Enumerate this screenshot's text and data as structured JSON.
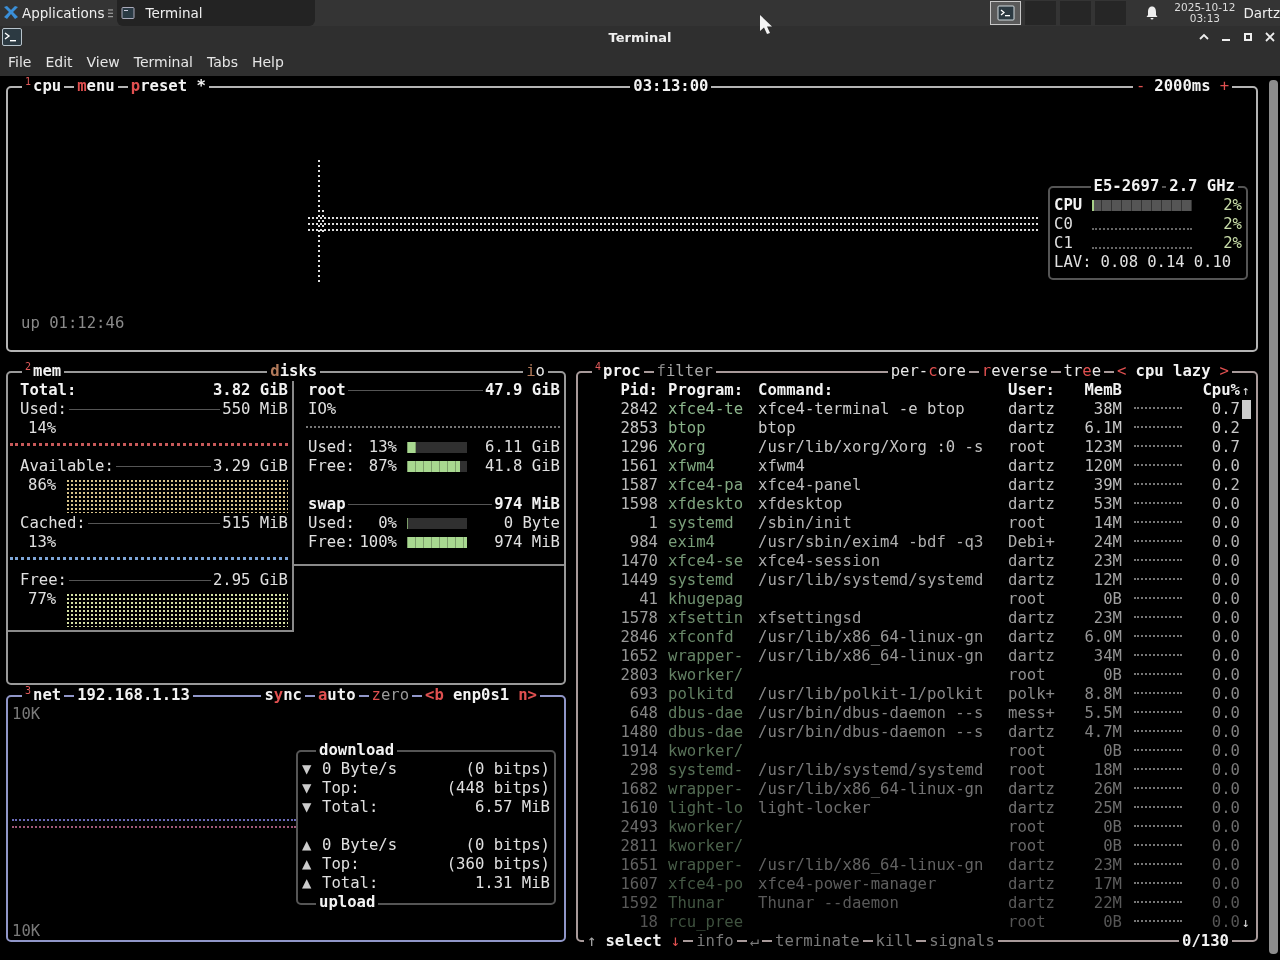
{
  "top_panel": {
    "applications": "Applications",
    "tasks": [
      {
        "label": "Terminal",
        "selected": true
      }
    ],
    "workspaces": [
      {
        "selected": true
      },
      {
        "selected": false
      },
      {
        "selected": false
      },
      {
        "selected": false
      }
    ],
    "date": "2025-10-12",
    "time": "03:13",
    "user": "Dartz"
  },
  "window": {
    "title": "Terminal"
  },
  "menu": [
    "File",
    "Edit",
    "View",
    "Terminal",
    "Tabs",
    "Help"
  ],
  "cpu": {
    "num": "1",
    "label": "cpu",
    "buttons": [
      {
        "key": "m",
        "rest": "enu"
      },
      {
        "key": "p",
        "rest": "reset *"
      }
    ],
    "clock": "03:13:00",
    "interval": {
      "minus": "-",
      "value": "2000ms",
      "plus": "+"
    },
    "uptime": "up 01:12:46",
    "info": {
      "model": "E5-2697",
      "freq": "2.7 GHz",
      "total": {
        "label": "CPU",
        "level": 0.02,
        "percent": "2%"
      },
      "cores": [
        {
          "label": "C0",
          "percent": "2%"
        },
        {
          "label": "C1",
          "percent": "2%"
        }
      ],
      "load_label": "LAV:",
      "load": [
        "0.08",
        "0.14",
        "0.10"
      ]
    }
  },
  "mem": {
    "num": "2",
    "label": "mem",
    "total": {
      "label": "Total:",
      "value": "3.82 GiB"
    },
    "items": [
      {
        "label": "Used:",
        "value": "550 MiB",
        "percent": "14%",
        "kind": "line",
        "color": "#c85a5a"
      },
      {
        "label": "Available:",
        "value": "3.29 GiB",
        "percent": "86%",
        "kind": "graph",
        "color": "#d9c48a"
      },
      {
        "label": "Cached:",
        "value": "515 MiB",
        "percent": "13%",
        "kind": "line",
        "color": "#7ea6d8"
      },
      {
        "label": "Free:",
        "value": "2.95 GiB",
        "percent": "77%",
        "kind": "graph",
        "color": "#d6e0a4"
      }
    ]
  },
  "disks": {
    "title": {
      "key": "d",
      "rest": "isks"
    },
    "io": {
      "key": "i",
      "rest": "o"
    },
    "list": [
      {
        "name": "root",
        "size": "47.9 GiB",
        "io_label": "IO%",
        "rows": [
          {
            "label": "Used:",
            "percent": "13%",
            "level": 0.13,
            "value": "6.11 GiB"
          },
          {
            "label": "Free:",
            "percent": "87%",
            "level": 0.87,
            "value": "41.8 GiB"
          }
        ]
      },
      {
        "name": "swap",
        "size": "974 MiB",
        "rows": [
          {
            "label": "Used:",
            "percent": "0%",
            "level": 0,
            "value": "0 Byte"
          },
          {
            "label": "Free:",
            "percent": "100%",
            "level": 1,
            "value": "974 MiB"
          }
        ]
      }
    ]
  },
  "net": {
    "num": "3",
    "label": "net",
    "ip": "192.168.1.13",
    "toggles": [
      {
        "pre": "s",
        "key": "y",
        "rest": "nc",
        "on": true
      },
      {
        "key": "a",
        "rest": "uto",
        "on": true
      },
      {
        "key": "z",
        "rest": "ero",
        "on": false
      }
    ],
    "iface": {
      "prev": "<b",
      "name": "enp0s1",
      "next": "n>"
    },
    "scale_top": "10K",
    "scale_bottom": "10K",
    "download": {
      "title": "download",
      "rows": [
        {
          "arrow": "▼",
          "label": "0 Byte/s",
          "value": "(0 bitps)"
        },
        {
          "arrow": "▼",
          "label": "Top:",
          "value": "(448 bitps)"
        },
        {
          "arrow": "▼",
          "label": "Total:",
          "value": "6.57 MiB"
        }
      ]
    },
    "upload": {
      "title": "upload",
      "rows": [
        {
          "arrow": "▲",
          "label": "0 Byte/s",
          "value": "(0 bitps)"
        },
        {
          "arrow": "▲",
          "label": "Top:",
          "value": "(360 bitps)"
        },
        {
          "arrow": "▲",
          "label": "Total:",
          "value": "1.31 MiB"
        }
      ]
    }
  },
  "proc": {
    "num": "4",
    "label": "proc",
    "filter": {
      "key": "f",
      "rest": "ilter"
    },
    "options": [
      {
        "pre": "per-",
        "key": "c",
        "rest": "ore"
      },
      {
        "key": "r",
        "rest": "everse"
      },
      {
        "pre": "tr",
        "key": "e",
        "rest": "e"
      }
    ],
    "sort": {
      "prev": "<",
      "label": "cpu lazy",
      "next": ">"
    },
    "columns": [
      "Pid:",
      "Program:",
      "Command:",
      "User:",
      "MemB",
      "Cpu%"
    ],
    "scroll_up": "↑",
    "scroll_down": "↓",
    "rows": [
      {
        "pid": "2842",
        "program": "xfce4-te",
        "command": "xfce4-terminal -e btop",
        "user": "dartz",
        "mem": "38M",
        "cpu": "0.7"
      },
      {
        "pid": "2853",
        "program": "btop",
        "command": "btop",
        "user": "dartz",
        "mem": "6.1M",
        "cpu": "0.2"
      },
      {
        "pid": "1296",
        "program": "Xorg",
        "command": "/usr/lib/xorg/Xorg :0 -s",
        "user": "root",
        "mem": "123M",
        "cpu": "0.7"
      },
      {
        "pid": "1561",
        "program": "xfwm4",
        "command": "xfwm4",
        "user": "dartz",
        "mem": "120M",
        "cpu": "0.0"
      },
      {
        "pid": "1587",
        "program": "xfce4-pa",
        "command": "xfce4-panel",
        "user": "dartz",
        "mem": "39M",
        "cpu": "0.2"
      },
      {
        "pid": "1598",
        "program": "xfdeskto",
        "command": "xfdesktop",
        "user": "dartz",
        "mem": "53M",
        "cpu": "0.0"
      },
      {
        "pid": "1",
        "program": "systemd",
        "command": "/sbin/init",
        "user": "root",
        "mem": "14M",
        "cpu": "0.0"
      },
      {
        "pid": "984",
        "program": "exim4",
        "command": "/usr/sbin/exim4 -bdf -q3",
        "user": "Debi+",
        "mem": "24M",
        "cpu": "0.0"
      },
      {
        "pid": "1470",
        "program": "xfce4-se",
        "command": "xfce4-session",
        "user": "dartz",
        "mem": "23M",
        "cpu": "0.0"
      },
      {
        "pid": "1449",
        "program": "systemd",
        "command": "/usr/lib/systemd/systemd",
        "user": "dartz",
        "mem": "12M",
        "cpu": "0.0"
      },
      {
        "pid": "41",
        "program": "khugepag",
        "user": "root",
        "mem": "0B",
        "cpu": "0.0"
      },
      {
        "pid": "1578",
        "program": "xfsettin",
        "command": "xfsettingsd",
        "user": "dartz",
        "mem": "23M",
        "cpu": "0.0"
      },
      {
        "pid": "2846",
        "program": "xfconfd",
        "command": "/usr/lib/x86_64-linux-gn",
        "user": "dartz",
        "mem": "6.0M",
        "cpu": "0.0"
      },
      {
        "pid": "1652",
        "program": "wrapper-",
        "command": "/usr/lib/x86_64-linux-gn",
        "user": "dartz",
        "mem": "34M",
        "cpu": "0.0"
      },
      {
        "pid": "2803",
        "program": "kworker/",
        "user": "root",
        "mem": "0B",
        "cpu": "0.0"
      },
      {
        "pid": "693",
        "program": "polkitd",
        "command": "/usr/lib/polkit-1/polkit",
        "user": "polk+",
        "mem": "8.8M",
        "cpu": "0.0"
      },
      {
        "pid": "648",
        "program": "dbus-dae",
        "command": "/usr/bin/dbus-daemon --s",
        "user": "mess+",
        "mem": "5.5M",
        "cpu": "0.0"
      },
      {
        "pid": "1480",
        "program": "dbus-dae",
        "command": "/usr/bin/dbus-daemon --s",
        "user": "dartz",
        "mem": "4.7M",
        "cpu": "0.0"
      },
      {
        "pid": "1914",
        "program": "kworker/",
        "user": "root",
        "mem": "0B",
        "cpu": "0.0"
      },
      {
        "pid": "298",
        "program": "systemd-",
        "command": "/usr/lib/systemd/systemd",
        "user": "root",
        "mem": "18M",
        "cpu": "0.0"
      },
      {
        "pid": "1682",
        "program": "wrapper-",
        "command": "/usr/lib/x86_64-linux-gn",
        "user": "dartz",
        "mem": "26M",
        "cpu": "0.0"
      },
      {
        "pid": "1610",
        "program": "light-lo",
        "command": "light-locker",
        "user": "dartz",
        "mem": "25M",
        "cpu": "0.0"
      },
      {
        "pid": "2493",
        "program": "kworker/",
        "user": "root",
        "mem": "0B",
        "cpu": "0.0"
      },
      {
        "pid": "2811",
        "program": "kworker/",
        "user": "root",
        "mem": "0B",
        "cpu": "0.0"
      },
      {
        "pid": "1651",
        "program": "wrapper-",
        "command": "/usr/lib/x86_64-linux-gn",
        "user": "dartz",
        "mem": "23M",
        "cpu": "0.0"
      },
      {
        "pid": "1607",
        "program": "xfce4-po",
        "command": "xfce4-power-manager",
        "user": "dartz",
        "mem": "17M",
        "cpu": "0.0"
      },
      {
        "pid": "1592",
        "program": "Thunar",
        "command": "Thunar --daemon",
        "user": "dartz",
        "mem": "22M",
        "cpu": "0.0"
      },
      {
        "pid": "18",
        "program": "rcu_pree",
        "user": "root",
        "mem": "0B",
        "cpu": "0.0"
      }
    ],
    "footer": {
      "select": {
        "up": "↑",
        "label": "select",
        "down": "↓"
      },
      "actions": [
        {
          "label": "info",
          "key": "↵",
          "disabled": true
        },
        {
          "label": "terminate",
          "disabled": true
        },
        {
          "label": "kill",
          "disabled": true
        },
        {
          "label": "signals",
          "disabled": true
        }
      ],
      "count": "0/130"
    }
  }
}
